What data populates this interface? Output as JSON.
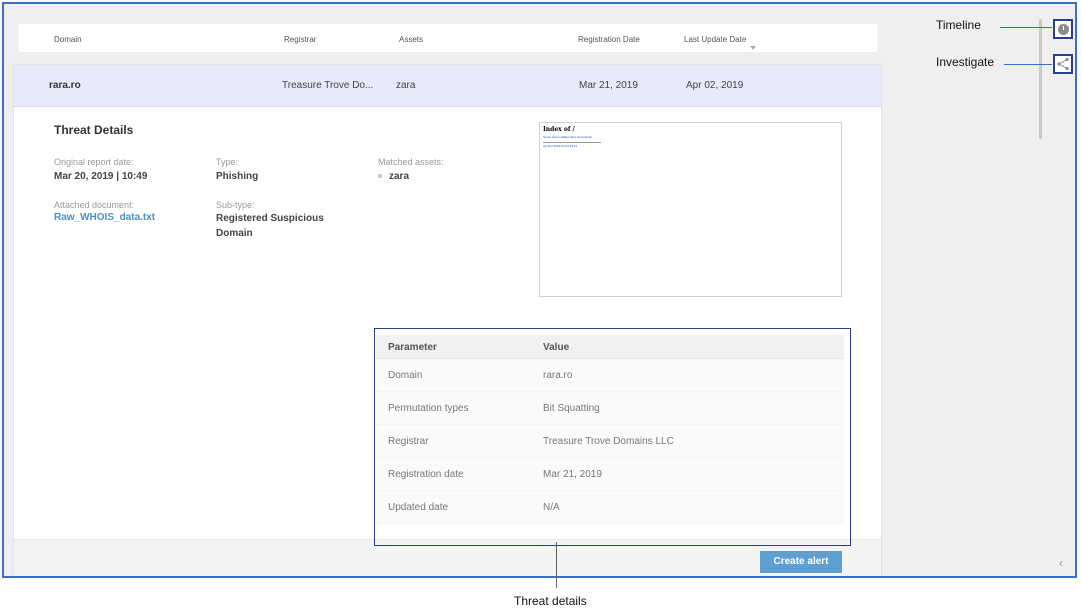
{
  "columns": {
    "domain": "Domain",
    "registrar": "Registrar",
    "assets": "Assets",
    "registration_date": "Registration Date",
    "last_update_date": "Last Update Date"
  },
  "selected_row": {
    "domain": "rara.ro",
    "registrar": "Treasure Trove Do...",
    "assets": "zara",
    "registration_date": "Mar 21, 2019",
    "last_update_date": "Apr 02, 2019"
  },
  "threat_details": {
    "title": "Threat Details",
    "original_report_label": "Original report date:",
    "original_report_value": "Mar 20, 2019 | 10:49",
    "type_label": "Type:",
    "type_value": "Phishing",
    "matched_assets_label": "Matched assets:",
    "matched_assets_value": "zara",
    "attached_doc_label": "Attached document:",
    "attached_doc_value": "Raw_WHOIS_data.txt",
    "subtype_label": "Sub-type:",
    "subtype_value_line1": "Registered Suspicious",
    "subtype_value_line2": "Domain"
  },
  "preview": {
    "title": "Index of /",
    "links": "Name   Last modified   Size Description",
    "row": "cgi-bin/   2019-03-04 09:14"
  },
  "param_table": {
    "headers": [
      "Parameter",
      "Value"
    ],
    "rows": [
      [
        "Domain",
        "rara.ro"
      ],
      [
        "Permutation types",
        "Bit Squatting"
      ],
      [
        "Registrar",
        "Treasure Trove Domains LLC"
      ],
      [
        "Registration date",
        "Mar 21, 2019"
      ],
      [
        "Updated date",
        "N/A"
      ]
    ]
  },
  "footer": {
    "create_alert": "Create alert"
  },
  "callouts": {
    "timeline": "Timeline",
    "investigate": "Investigate",
    "threat_details": "Threat details"
  },
  "icons": {
    "timeline": "clock-icon",
    "investigate": "share-icon",
    "collapse": "chevron-left-icon"
  },
  "colors": {
    "selected_row": "#e8e9fb",
    "accent_button": "#5d9fd0",
    "link": "#4a90c8",
    "annotation_border": "#27408b"
  }
}
